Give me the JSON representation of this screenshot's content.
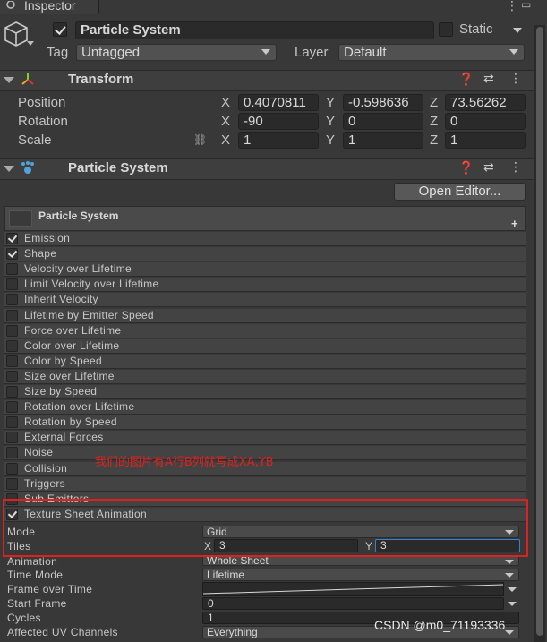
{
  "inspector_tab": {
    "label": "Inspector"
  },
  "gameobject": {
    "name": "Particle System",
    "static_label": "Static",
    "tag_label": "Tag",
    "tag_value": "Untagged",
    "layer_label": "Layer",
    "layer_value": "Default"
  },
  "transform": {
    "title": "Transform",
    "rows": [
      {
        "label": "Position",
        "x": "0.4070811",
        "y": "-0.598636",
        "z": "73.56262"
      },
      {
        "label": "Rotation",
        "x": "-90",
        "y": "0",
        "z": "0"
      },
      {
        "label": "Scale",
        "x": "1",
        "y": "1",
        "z": "1"
      }
    ],
    "axis": {
      "x": "X",
      "y": "Y",
      "z": "Z"
    }
  },
  "particle_component": {
    "title": "Particle System",
    "open_editor_label": "Open Editor...",
    "main_module_label": "Particle System"
  },
  "modules": [
    {
      "label": "Emission",
      "checked": true
    },
    {
      "label": "Shape",
      "checked": true
    },
    {
      "label": "Velocity over Lifetime",
      "checked": false
    },
    {
      "label": "Limit Velocity over Lifetime",
      "checked": false
    },
    {
      "label": "Inherit Velocity",
      "checked": false
    },
    {
      "label": "Lifetime by Emitter Speed",
      "checked": false
    },
    {
      "label": "Force over Lifetime",
      "checked": false
    },
    {
      "label": "Color over Lifetime",
      "checked": false
    },
    {
      "label": "Color by Speed",
      "checked": false
    },
    {
      "label": "Size over Lifetime",
      "checked": false
    },
    {
      "label": "Size by Speed",
      "checked": false
    },
    {
      "label": "Rotation over Lifetime",
      "checked": false
    },
    {
      "label": "Rotation by Speed",
      "checked": false
    },
    {
      "label": "External Forces",
      "checked": false
    },
    {
      "label": "Noise",
      "checked": false
    },
    {
      "label": "Collision",
      "checked": false
    },
    {
      "label": "Triggers",
      "checked": false
    },
    {
      "label": "Sub Emitters",
      "checked": false
    },
    {
      "label": "Texture Sheet Animation",
      "checked": true
    }
  ],
  "texture_sheet": {
    "mode_label": "Mode",
    "mode_value": "Grid",
    "tiles_label": "Tiles",
    "tiles_x_axis": "X",
    "tiles_x": "3",
    "tiles_y_axis": "Y",
    "tiles_y": "3",
    "animation_label": "Animation",
    "animation_value": "Whole Sheet",
    "time_mode_label": "Time Mode",
    "time_mode_value": "Lifetime",
    "frame_over_time_label": "Frame over Time",
    "start_frame_label": "Start Frame",
    "start_frame_value": "0",
    "cycles_label": "Cycles",
    "cycles_value": "1",
    "uv_channels_label": "Affected UV Channels",
    "uv_channels_value": "Everything"
  },
  "annotation": {
    "text": "我们的图片有A行B列就写成XA,YB"
  },
  "watermark": {
    "text": "CSDN @m0_71193336"
  },
  "colors": {
    "highlight_red": "#e02020",
    "field_bg": "#2a2a2a",
    "panel_bg": "#383838"
  }
}
